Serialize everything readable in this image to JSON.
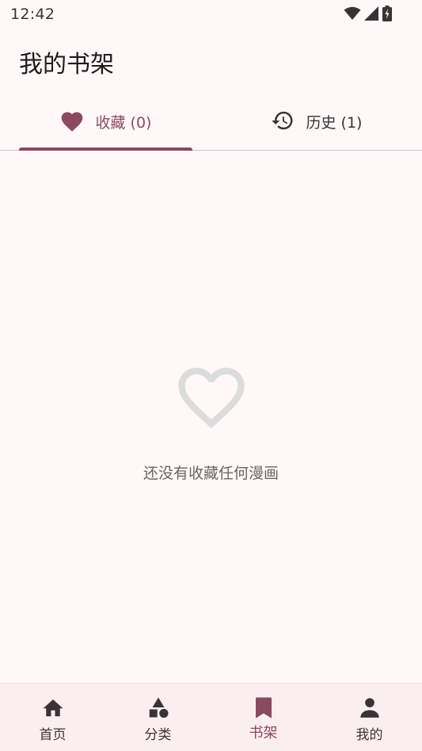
{
  "status_bar": {
    "time": "12:42"
  },
  "app_bar": {
    "title": "我的书架"
  },
  "tabs": [
    {
      "label": "收藏 (0)",
      "icon": "heart-filled-icon",
      "selected": true
    },
    {
      "label": "历史 (1)",
      "icon": "history-icon",
      "selected": false
    }
  ],
  "empty_state": {
    "icon": "heart-outline-icon",
    "message": "还没有收藏任何漫画"
  },
  "bottom_nav": [
    {
      "label": "首页",
      "icon": "home-icon",
      "selected": false
    },
    {
      "label": "分类",
      "icon": "category-icon",
      "selected": false
    },
    {
      "label": "书架",
      "icon": "bookmark-icon",
      "selected": true
    },
    {
      "label": "我的",
      "icon": "person-icon",
      "selected": false
    }
  ],
  "colors": {
    "background": "#fff8f7",
    "accent": "#8a4a60",
    "nav_background": "#fbeef0",
    "empty_icon": "#dcdcdc",
    "muted_text": "#6c6466"
  }
}
